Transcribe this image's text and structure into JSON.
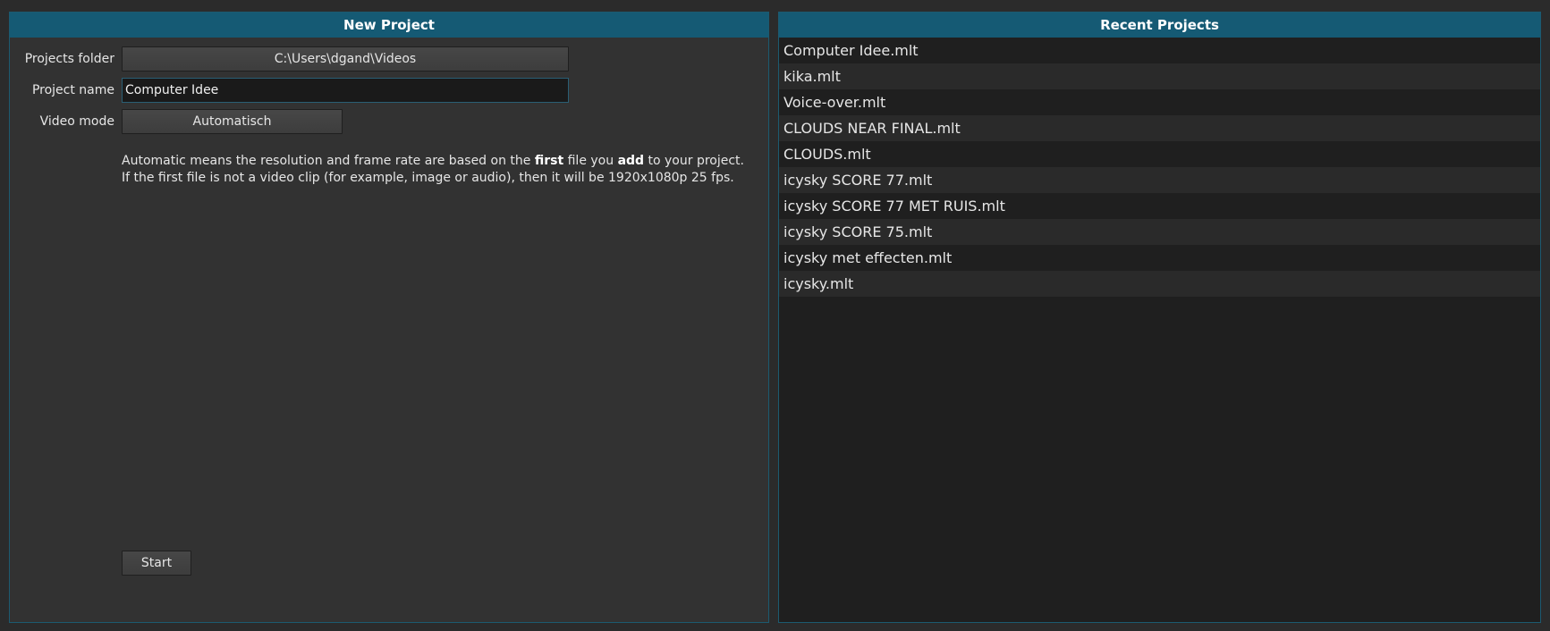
{
  "new_project": {
    "title": "New Project",
    "projects_folder": {
      "label": "Projects folder",
      "value": "C:\\Users\\dgand\\Videos"
    },
    "project_name": {
      "label": "Project name",
      "value": "Computer Idee"
    },
    "video_mode": {
      "label": "Video mode",
      "value": "Automatisch"
    },
    "help": {
      "part1": "Automatic means the resolution and frame rate are based on the ",
      "bold1": "first",
      "part2": " file you ",
      "bold2": "add",
      "part3": " to your project.",
      "line2": "If the first file is not a video clip (for example, image or audio), then it will be 1920x1080p 25 fps."
    },
    "start_label": "Start"
  },
  "recent_projects": {
    "title": "Recent Projects",
    "items": [
      "Computer Idee.mlt",
      "kika.mlt",
      "Voice-over.mlt",
      "CLOUDS NEAR FINAL.mlt",
      "CLOUDS.mlt",
      "icysky SCORE 77.mlt",
      "icysky SCORE 77 MET RUIS.mlt",
      "icysky SCORE 75.mlt",
      "icysky met effecten.mlt",
      "icysky.mlt"
    ]
  },
  "colors": {
    "header_bg": "#155a74",
    "panel_border": "#1c5a70",
    "left_panel_bg": "#323232",
    "right_panel_bg": "#1f1f1f"
  }
}
